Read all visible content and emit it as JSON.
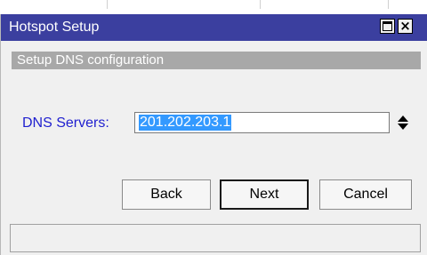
{
  "window": {
    "title": "Hotspot Setup",
    "controls": {
      "restore_icon": "restore-icon",
      "close_icon": "close-icon"
    }
  },
  "section": {
    "header": "Setup DNS configuration"
  },
  "form": {
    "dns_label": "DNS Servers:",
    "dns_value": "201.202.203.1",
    "spinner_icon": "up-down-arrows-icon"
  },
  "buttons": {
    "back": "Back",
    "next": "Next",
    "cancel": "Cancel"
  },
  "status": {
    "text": ""
  },
  "colors": {
    "titlebar": "#3b3f9f",
    "section_header": "#a8a8a8",
    "label_blue": "#1f1fcf",
    "selection": "#3399ff"
  }
}
